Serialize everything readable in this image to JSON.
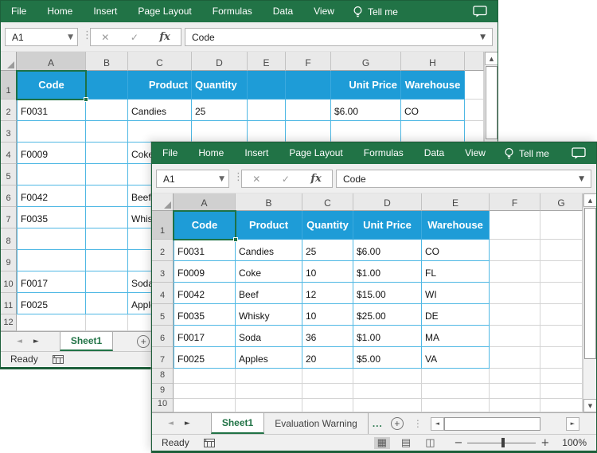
{
  "ribbon": {
    "tabs": [
      "File",
      "Home",
      "Insert",
      "Page Layout",
      "Formulas",
      "Data",
      "View"
    ],
    "tell_me": "Tell me"
  },
  "formula_bar": {
    "name_box": "A1",
    "fx_label": "fx",
    "value": "Code"
  },
  "back_sheet": {
    "column_headers": [
      "A",
      "B",
      "C",
      "D",
      "E",
      "F",
      "G",
      "H"
    ],
    "row_headers": [
      "1",
      "2",
      "3",
      "4",
      "5",
      "6",
      "7",
      "8",
      "9",
      "10",
      "11",
      "12"
    ],
    "cells": {
      "1": {
        "A": "Code",
        "C": "Product",
        "D": "Quantity",
        "G": "Unit Price",
        "H": "Warehouse"
      },
      "2": {
        "A": "F0031",
        "C": "Candies",
        "D": "25",
        "G": "$6.00",
        "H": "CO"
      },
      "4": {
        "A": "F0009",
        "C": "Coke"
      },
      "6": {
        "A": "F0042",
        "C": "Beef"
      },
      "7": {
        "A": "F0035",
        "C": "Whisky"
      },
      "10": {
        "A": "F0017",
        "C": "Soda"
      },
      "11": {
        "A": "F0025",
        "C": "Apples"
      }
    },
    "selected_cell": "A1",
    "sheet_tab": "Sheet1",
    "status_ready": "Ready"
  },
  "front_sheet": {
    "column_headers": [
      "A",
      "B",
      "C",
      "D",
      "E",
      "F",
      "G"
    ],
    "row_headers": [
      "1",
      "2",
      "3",
      "4",
      "5",
      "6",
      "7",
      "8",
      "9",
      "10"
    ],
    "cells": {
      "1": {
        "A": "Code",
        "B": "Product",
        "C": "Quantity",
        "D": "Unit Price",
        "E": "Warehouse"
      },
      "2": {
        "A": "F0031",
        "B": "Candies",
        "C": "25",
        "D": "$6.00",
        "E": "CO"
      },
      "3": {
        "A": "F0009",
        "B": "Coke",
        "C": "10",
        "D": "$1.00",
        "E": "FL"
      },
      "4": {
        "A": "F0042",
        "B": "Beef",
        "C": "12",
        "D": "$15.00",
        "E": "WI"
      },
      "5": {
        "A": "F0035",
        "B": "Whisky",
        "C": "10",
        "D": "$25.00",
        "E": "DE"
      },
      "6": {
        "A": "F0017",
        "B": "Soda",
        "C": "36",
        "D": "$1.00",
        "E": "MA"
      },
      "7": {
        "A": "F0025",
        "B": "Apples",
        "C": "20",
        "D": "$5.00",
        "E": "VA"
      }
    },
    "selected_cell": "A1",
    "tabs": [
      {
        "label": "Sheet1",
        "active": true
      },
      {
        "label": "Evaluation Warning",
        "active": false
      }
    ],
    "tab_overflow": "...",
    "status_ready": "Ready",
    "zoom_level": "100%"
  },
  "colors": {
    "ribbon_green": "#217346",
    "window_border": "#1d5f3a",
    "table_header_blue": "#1e9cd7",
    "table_border_blue": "#4fb8e4",
    "selection_green": "#1e7145",
    "active_tab_green": "#217346"
  }
}
